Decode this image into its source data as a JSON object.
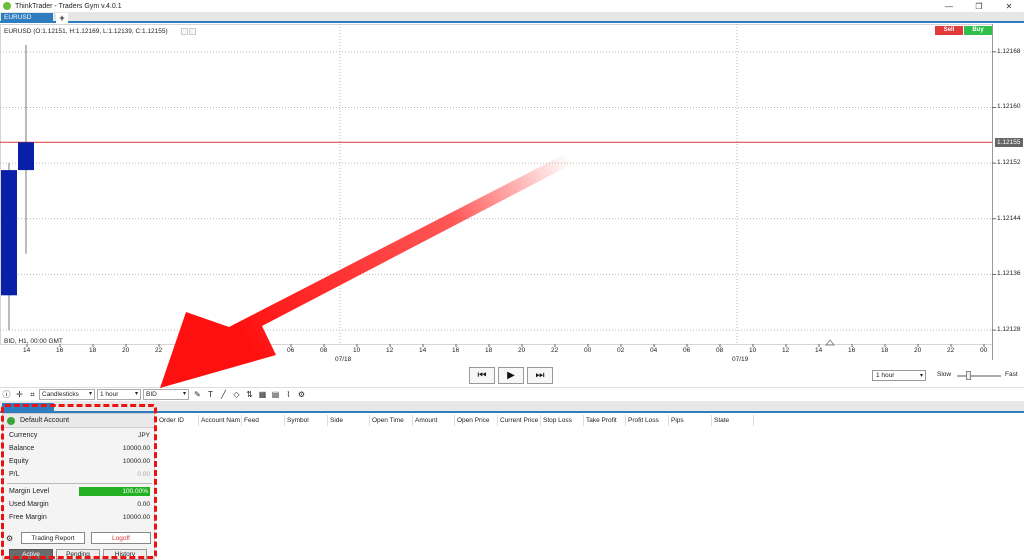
{
  "window": {
    "title": "ThinkTrader - Traders Gym v.4.0.1",
    "controls": [
      "minimize",
      "maximize",
      "close"
    ]
  },
  "tabs": {
    "active": "EURUSD",
    "add_label": "+"
  },
  "chart": {
    "symbol_ohlc": "EURUSD (O:1.12151, H:1.12169, L:1.12139, C:1.12155)",
    "info": "BID, H1, 00:00 GMT",
    "sell_label": "Sell",
    "buy_label": "Buy",
    "current_price": "1.12155",
    "price_ticks": [
      "1.12168",
      "1.12160",
      "1.12152",
      "1.12144",
      "1.12136",
      "1.12128"
    ],
    "time_ticks": [
      "14",
      "16",
      "18",
      "20",
      "22",
      "00",
      "02",
      "04",
      "06",
      "08",
      "10",
      "12",
      "14",
      "16",
      "18",
      "20",
      "22",
      "00",
      "02",
      "04",
      "06",
      "08",
      "10",
      "12",
      "14",
      "16",
      "18",
      "20",
      "22",
      "00"
    ],
    "date_labels": [
      "07/18",
      "07/19"
    ],
    "colors": {
      "candle": "#0a1fa8",
      "price_line": "#e03a3a",
      "grid": "#bbbbbb"
    }
  },
  "chart_data": {
    "type": "candlestick",
    "symbol": "EURUSD",
    "x": [
      "13",
      "14"
    ],
    "candles": [
      {
        "time": "13",
        "open": 1.12151,
        "high": 1.12152,
        "low": 1.12128,
        "close": 1.12133
      },
      {
        "time": "14",
        "open": 1.12151,
        "high": 1.12169,
        "low": 1.12139,
        "close": 1.12155
      }
    ],
    "ylim": [
      1.12126,
      1.12172
    ],
    "grid": true
  },
  "playback": {
    "rewind_icon": "skip-back-icon",
    "play_icon": "play-icon",
    "forward_icon": "skip-forward-icon",
    "timeframe": "1 hour",
    "speed_slow": "Slow",
    "speed_fast": "Fast",
    "speed_level": 0.2
  },
  "toolbar": {
    "chart_type": "Candlesticks",
    "timeframe": "1 hour",
    "price_type": "BID"
  },
  "positions_table": {
    "columns": [
      "Order ID",
      "Account Nam",
      "Feed",
      "Symbol",
      "Side",
      "Open Time",
      "Amount",
      "Open Price",
      "Current Price",
      "Stop Loss",
      "Take Profit",
      "Profit Loss",
      "Pips",
      "State"
    ]
  },
  "account": {
    "name": "Default Account",
    "rows": [
      {
        "label": "Currency",
        "value": "JPY"
      },
      {
        "label": "Balance",
        "value": "10000.00"
      },
      {
        "label": "Equity",
        "value": "10000.00"
      },
      {
        "label": "P/L",
        "value": "0.00"
      }
    ],
    "margin_level_label": "Margin Level",
    "margin_level_value": "100.00%",
    "used_margin_label": "Used Margin",
    "used_margin_value": "0.00",
    "free_margin_label": "Free Margin",
    "free_margin_value": "10000.00",
    "trading_report": "Trading Report",
    "logoff": "Logoff",
    "tabs": [
      "Active",
      "Pending",
      "History"
    ]
  }
}
